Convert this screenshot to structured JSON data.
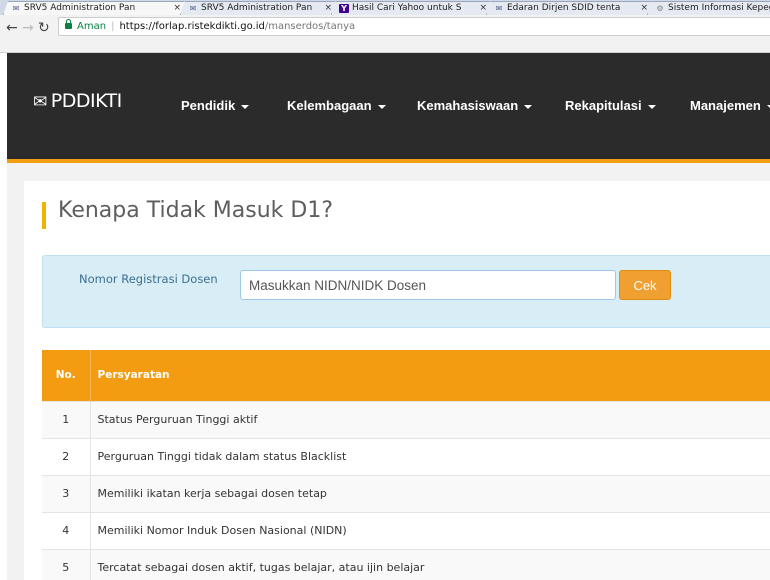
{
  "browser": {
    "tabs": [
      {
        "title": "SRV5 Administration Pan",
        "favicon": "pddikti-favicon",
        "active": true
      },
      {
        "title": "SRV5 Administration Pan",
        "favicon": "pddikti-favicon",
        "active": false
      },
      {
        "title": "Hasil Cari Yahoo untuk S",
        "favicon": "yahoo-favicon",
        "active": false
      },
      {
        "title": "Edaran Dirjen SDID tenta",
        "favicon": "pddikti-favicon",
        "active": false
      },
      {
        "title": "Sistem Informasi Kepeg",
        "favicon": "gear-favicon",
        "active": false
      }
    ],
    "close_glyph": "×",
    "secure_label": "Aman",
    "url_host": "https://forlap.ristekdikti.go.id",
    "url_path": "/manserdos/tanya"
  },
  "header": {
    "logo_text": "PDDIKTI",
    "menu": [
      {
        "label": "Pendidik"
      },
      {
        "label": "Kelembagaan"
      },
      {
        "label": "Kemahasiswaan"
      },
      {
        "label": "Rekapitulasi"
      },
      {
        "label": "Manajemen"
      }
    ]
  },
  "page": {
    "title": "Kenapa Tidak Masuk D1?"
  },
  "form": {
    "label": "Nomor Registrasi Dosen",
    "input_placeholder": "Masukkan NIDN/NIDK Dosen",
    "input_value": "",
    "button_label": "Cek"
  },
  "table": {
    "headers": {
      "no": "No.",
      "requirement": "Persyaratan"
    },
    "rows": [
      {
        "no": "1",
        "text": "Status Perguruan Tinggi aktif"
      },
      {
        "no": "2",
        "text": "Perguruan Tinggi tidak dalam status Blacklist"
      },
      {
        "no": "3",
        "text": "Memiliki ikatan kerja sebagai dosen tetap"
      },
      {
        "no": "4",
        "text": "Memiliki Nomor Induk Dosen Nasional (NIDN)"
      },
      {
        "no": "5",
        "text": "Tercatat sebagai dosen aktif, tugas belajar, atau ijin belajar"
      }
    ]
  },
  "colors": {
    "accent": "#f39c12",
    "header_bg": "#2b2b2b",
    "info_box_bg": "#d9edf7",
    "button_bg": "#f0a030",
    "title_bar": "#f0b400"
  }
}
